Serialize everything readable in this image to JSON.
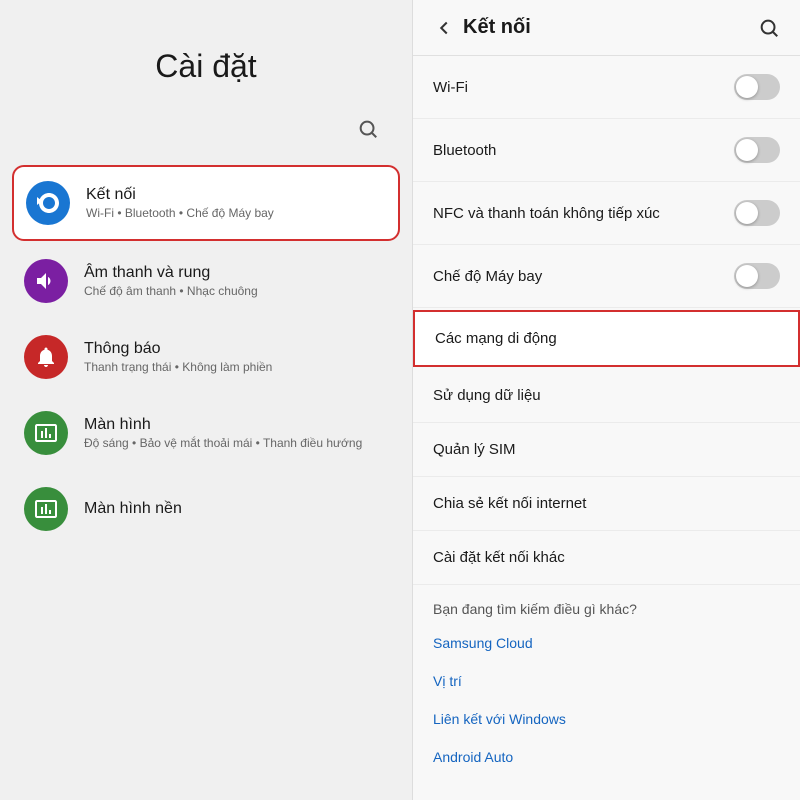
{
  "left": {
    "title": "Cài đặt",
    "items": [
      {
        "id": "ket-noi",
        "title": "Kết nối",
        "sub": "Wi-Fi • Bluetooth • Chế độ Máy bay",
        "icon_color": "blue",
        "highlighted": true
      },
      {
        "id": "am-thanh",
        "title": "Âm thanh và rung",
        "sub": "Chế độ âm thanh • Nhạc chuông",
        "icon_color": "purple",
        "highlighted": false
      },
      {
        "id": "thong-bao",
        "title": "Thông báo",
        "sub": "Thanh trạng thái • Không làm phiền",
        "icon_color": "red",
        "highlighted": false
      },
      {
        "id": "man-hinh",
        "title": "Màn hình",
        "sub": "Độ sáng • Bảo vệ mắt thoải mái • Thanh điều hướng",
        "icon_color": "green",
        "highlighted": false
      },
      {
        "id": "man-hinh-nen",
        "title": "Màn hình nền",
        "sub": "",
        "icon_color": "green",
        "highlighted": false
      }
    ]
  },
  "right": {
    "title": "Kết nối",
    "back_label": "‹",
    "items": [
      {
        "id": "wifi",
        "label": "Wi-Fi",
        "has_toggle": true,
        "highlighted": false
      },
      {
        "id": "bluetooth",
        "label": "Bluetooth",
        "has_toggle": true,
        "highlighted": false
      },
      {
        "id": "nfc",
        "label": "NFC và thanh toán không tiếp xúc",
        "has_toggle": true,
        "highlighted": false
      },
      {
        "id": "may-bay",
        "label": "Chế độ Máy bay",
        "has_toggle": true,
        "highlighted": false
      },
      {
        "id": "mang-di-dong",
        "label": "Các mạng di động",
        "has_toggle": false,
        "highlighted": true
      },
      {
        "id": "su-dung-du-lieu",
        "label": "Sử dụng dữ liệu",
        "has_toggle": false,
        "highlighted": false
      },
      {
        "id": "quan-ly-sim",
        "label": "Quản lý SIM",
        "has_toggle": false,
        "highlighted": false
      },
      {
        "id": "chia-se",
        "label": "Chia sẻ kết nối internet",
        "has_toggle": false,
        "highlighted": false
      },
      {
        "id": "cai-dat-khac",
        "label": "Cài đặt kết nối khác",
        "has_toggle": false,
        "highlighted": false
      }
    ],
    "section_label": "Bạn đang tìm kiếm điều gì khác?",
    "links": [
      {
        "id": "samsung-cloud",
        "label": "Samsung Cloud"
      },
      {
        "id": "vi-tri",
        "label": "Vị trí"
      },
      {
        "id": "lien-ket-windows",
        "label": "Liên kết với Windows"
      },
      {
        "id": "android-auto",
        "label": "Android Auto"
      }
    ]
  }
}
